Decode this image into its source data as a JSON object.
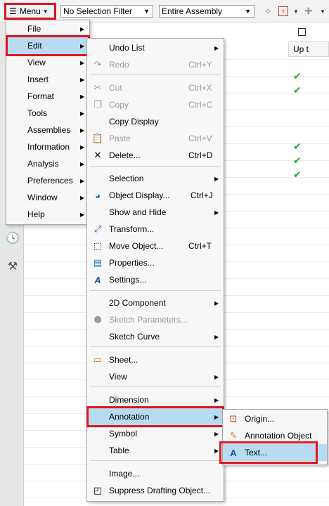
{
  "toolbar": {
    "menu_label": "Menu",
    "selection_filter": "No Selection Filter",
    "scope": "Entire Assembly"
  },
  "nav": {
    "column_header": "Up t"
  },
  "main_menu": {
    "items": [
      {
        "label": "File"
      },
      {
        "label": "Edit"
      },
      {
        "label": "View"
      },
      {
        "label": "Insert"
      },
      {
        "label": "Format"
      },
      {
        "label": "Tools"
      },
      {
        "label": "Assemblies"
      },
      {
        "label": "Information"
      },
      {
        "label": "Analysis"
      },
      {
        "label": "Preferences"
      },
      {
        "label": "Window"
      },
      {
        "label": "Help"
      }
    ]
  },
  "edit_menu": {
    "undo_list": "Undo List",
    "redo": "Redo",
    "redo_sc": "Ctrl+Y",
    "cut": "Cut",
    "cut_sc": "Ctrl+X",
    "copy": "Copy",
    "copy_sc": "Ctrl+C",
    "copy_display": "Copy Display",
    "paste": "Paste",
    "paste_sc": "Ctrl+V",
    "delete": "Delete...",
    "delete_sc": "Ctrl+D",
    "selection": "Selection",
    "object_display": "Object Display...",
    "object_display_sc": "Ctrl+J",
    "show_hide": "Show and Hide",
    "transform": "Transform...",
    "move_object": "Move Object...",
    "move_object_sc": "Ctrl+T",
    "properties": "Properties...",
    "settings": "Settings...",
    "component_2d": "2D Component",
    "sketch_params": "Sketch Parameters...",
    "sketch_curve": "Sketch Curve",
    "sheet": "Sheet...",
    "view": "View",
    "dimension": "Dimension",
    "annotation": "Annotation",
    "symbol": "Symbol",
    "table": "Table",
    "image": "Image...",
    "suppress": "Suppress Drafting Object..."
  },
  "annotation_menu": {
    "origin": "Origin...",
    "annotation_object": "Annotation Object",
    "text": "Text..."
  },
  "colors": {
    "highlight": "#b7dcf1",
    "red_outline": "#e0141e",
    "check": "#22a33a"
  }
}
